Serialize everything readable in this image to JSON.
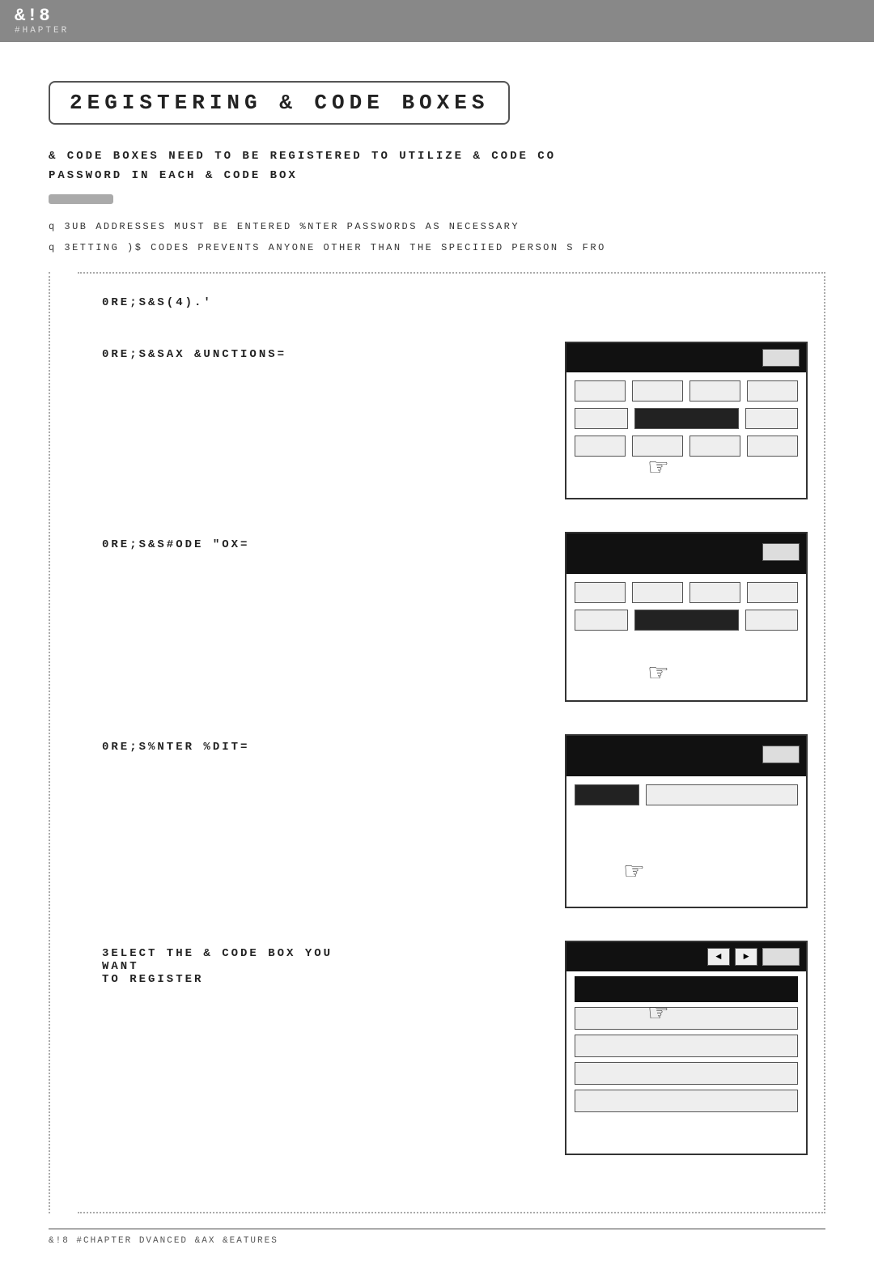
{
  "header": {
    "title": "&!8",
    "subtitle": "#HAPTER"
  },
  "chapter": {
    "title": "2EGISTERING & CODE BOXES",
    "intro_line1": "& CODE BOXES NEED TO BE REGISTERED TO UTILIZE & CODE CO",
    "intro_line2": "PASSWORD IN EACH & CODE BOX",
    "bullet1": "3UB ADDRESSES MUST BE ENTERED  %NTER PASSWORDS AS NECESSARY",
    "bullet2": "3ETTING )$  CODES PREVENTS ANYONE OTHER THAN THE SPECIIED PERSON S  FRO"
  },
  "steps": [
    {
      "id": "step1",
      "text": "0RE;S&S(4).'",
      "has_panel": false
    },
    {
      "id": "step2",
      "text": "0RE;S&SAX &UNCTIONS=",
      "has_panel": true
    },
    {
      "id": "step3",
      "text": "0RE;S&S#ODE \"OX=",
      "has_panel": true
    },
    {
      "id": "step4",
      "text": "0RE;S%NTER %DIT=",
      "has_panel": true
    },
    {
      "id": "step5",
      "text1": "3ELECT THE & CODE BOX YOU WANT",
      "text2": "TO REGISTER",
      "has_panel": true
    }
  ],
  "footer": {
    "text": "&!8 #CHAPTER DVANCED &AX &EATURES"
  }
}
